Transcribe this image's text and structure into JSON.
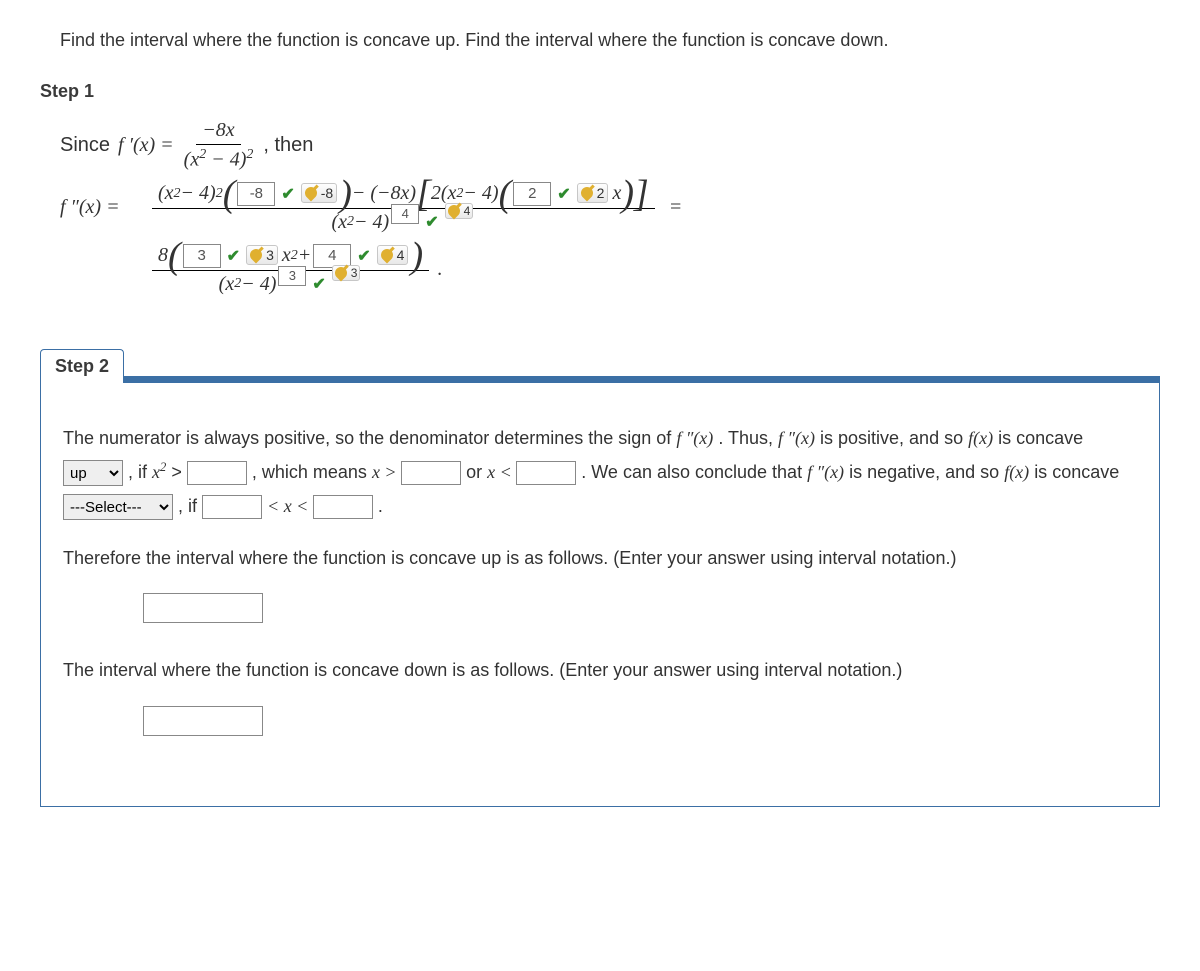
{
  "question": "Find the interval where the function is concave up. Find the interval where the function is concave down.",
  "step1": {
    "label": "Step 1",
    "since": "Since",
    "fprime": "f ′(x) =",
    "frac1_num": "−8x",
    "frac1_den_a": "(x",
    "frac1_den_b": " − 4)",
    "then": ", then",
    "fpp": "f ″(x) =",
    "num_a": "(x",
    "num_b": " − 4)",
    "box1": "-8",
    "key1": "-8",
    "num_mid": " − (−8x)",
    "num_c": "2(x",
    "num_d": " − 4)",
    "box2": "2",
    "key2": "2",
    "num_end": "x",
    "den1_a": "(x",
    "den1_b": " − 4)",
    "box3": "4",
    "key3": "4",
    "line3_pre": "8",
    "box4": "3",
    "key4": "3",
    "line3_mid": "x",
    "line3_plus": " + ",
    "box5": "4",
    "key5": "4",
    "den2_a": "(x",
    "den2_b": " − 4)",
    "box6": "3",
    "key6": "3",
    "equals": " = "
  },
  "step2": {
    "label": "Step 2",
    "text1a": "The numerator is always positive, so the denominator determines the sign of ",
    "fpp1": "f ″(x)",
    "text1b": ".  Thus, ",
    "fpp2": "f ″(x)",
    "text1c": "  is positive, and so  ",
    "fx1": "f(x)",
    "text1d": "  is concave ",
    "select1_value": "up",
    "text2a": ", if  ",
    "xsq": "x",
    "gt": " > ",
    "text2b": " ,  which means  ",
    "xgt": "x > ",
    "or": "  or  ",
    "xlt": "x < ",
    "text2c": " .   We can also conclude that  ",
    "fpp3": "f ″(x)",
    "text2d": "  is negative, and so  ",
    "fx2": "f(x)",
    "text2e": "  is concave ",
    "select2_placeholder": "---Select---",
    "text3a": " ,  if  ",
    "lt2": " < x < ",
    "text3b": " .",
    "para2": "Therefore the interval where the function is concave up is as follows. (Enter your answer using interval notation.)",
    "para3": "The interval where the function is concave down is as follows. (Enter your answer using interval notation.)"
  }
}
